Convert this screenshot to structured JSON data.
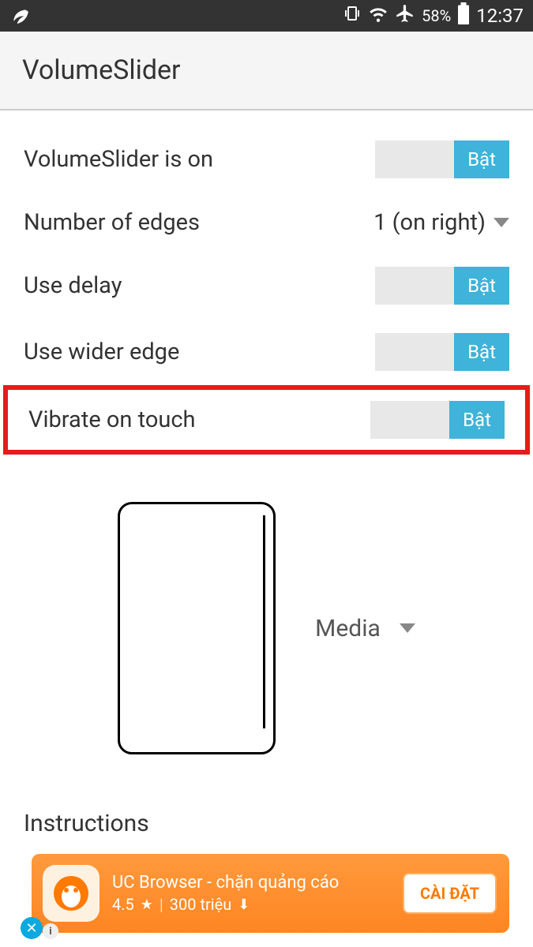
{
  "status": {
    "battery_pct": "58%",
    "time": "12:37"
  },
  "app": {
    "title": "VolumeSlider"
  },
  "settings": {
    "slider_on": {
      "label": "VolumeSlider is on",
      "toggle": "Bật"
    },
    "edges": {
      "label": "Number of edges",
      "value": "1 (on right)"
    },
    "delay": {
      "label": "Use delay",
      "toggle": "Bật"
    },
    "wider": {
      "label": "Use wider edge",
      "toggle": "Bật"
    },
    "vibrate": {
      "label": "Vibrate on touch",
      "toggle": "Bật"
    },
    "media": {
      "label": "Media"
    }
  },
  "instructions": {
    "heading": "Instructions"
  },
  "ad": {
    "title": "UC Browser - chặn quảng cáo",
    "rating": "4.5",
    "downloads": "300 triệu",
    "cta": "CÀI ĐẶT"
  }
}
